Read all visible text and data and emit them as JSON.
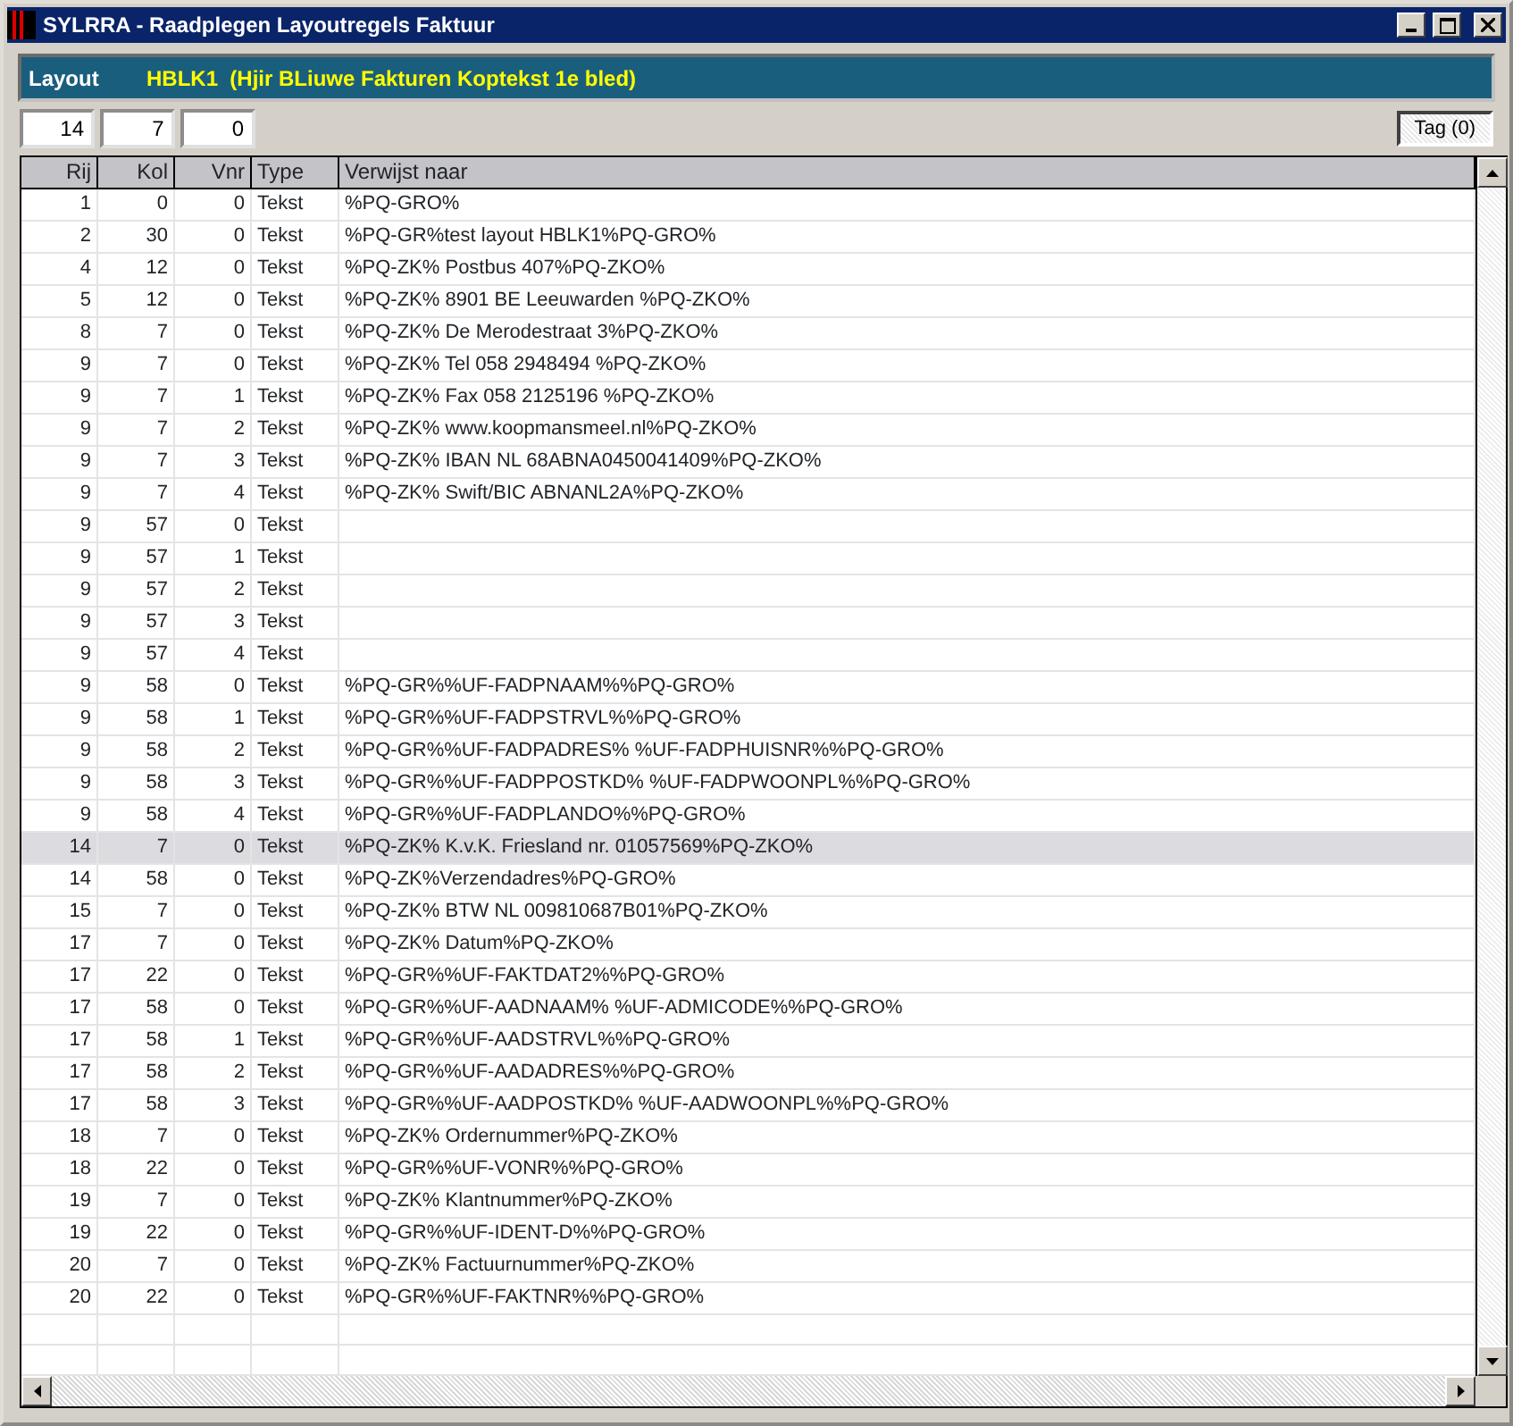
{
  "window": {
    "title": "SYLRRA - Raadplegen Layoutregels Faktuur"
  },
  "layout": {
    "label": "Layout",
    "value": "HBLK1  (Hjir BLiuwe Fakturen Koptekst 1e bled)"
  },
  "fields": [
    "14",
    "7",
    "0"
  ],
  "tag_button": "Tag (0)",
  "table": {
    "columns": [
      "Rij",
      "Kol",
      "Vnr",
      "Type",
      "Verwijst naar"
    ],
    "rows": [
      {
        "rij": "1",
        "kol": "0",
        "vnr": "0",
        "type": "Tekst",
        "ref": "%PQ-GRO%",
        "selected": false
      },
      {
        "rij": "2",
        "kol": "30",
        "vnr": "0",
        "type": "Tekst",
        "ref": "%PQ-GR%test layout HBLK1%PQ-GRO%",
        "selected": false
      },
      {
        "rij": "4",
        "kol": "12",
        "vnr": "0",
        "type": "Tekst",
        "ref": "%PQ-ZK% Postbus 407%PQ-ZKO%",
        "selected": false
      },
      {
        "rij": "5",
        "kol": "12",
        "vnr": "0",
        "type": "Tekst",
        "ref": "%PQ-ZK% 8901 BE Leeuwarden %PQ-ZKO%",
        "selected": false
      },
      {
        "rij": "8",
        "kol": "7",
        "vnr": "0",
        "type": "Tekst",
        "ref": "%PQ-ZK% De Merodestraat 3%PQ-ZKO%",
        "selected": false
      },
      {
        "rij": "9",
        "kol": "7",
        "vnr": "0",
        "type": "Tekst",
        "ref": "%PQ-ZK% Tel 058 2948494 %PQ-ZKO%",
        "selected": false
      },
      {
        "rij": "9",
        "kol": "7",
        "vnr": "1",
        "type": "Tekst",
        "ref": "%PQ-ZK% Fax 058 2125196 %PQ-ZKO%",
        "selected": false
      },
      {
        "rij": "9",
        "kol": "7",
        "vnr": "2",
        "type": "Tekst",
        "ref": "%PQ-ZK% www.koopmansmeel.nl%PQ-ZKO%",
        "selected": false
      },
      {
        "rij": "9",
        "kol": "7",
        "vnr": "3",
        "type": "Tekst",
        "ref": "%PQ-ZK% IBAN NL 68ABNA0450041409%PQ-ZKO%",
        "selected": false
      },
      {
        "rij": "9",
        "kol": "7",
        "vnr": "4",
        "type": "Tekst",
        "ref": "%PQ-ZK% Swift/BIC ABNANL2A%PQ-ZKO%",
        "selected": false
      },
      {
        "rij": "9",
        "kol": "57",
        "vnr": "0",
        "type": "Tekst",
        "selected": false
      },
      {
        "rij": "9",
        "kol": "57",
        "vnr": "1",
        "type": "Tekst",
        "selected": false
      },
      {
        "rij": "9",
        "kol": "57",
        "vnr": "2",
        "type": "Tekst",
        "selected": false
      },
      {
        "rij": "9",
        "kol": "57",
        "vnr": "3",
        "type": "Tekst",
        "selected": false
      },
      {
        "rij": "9",
        "kol": "57",
        "vnr": "4",
        "type": "Tekst",
        "selected": false
      },
      {
        "rij": "9",
        "kol": "58",
        "vnr": "0",
        "type": "Tekst",
        "ref": "%PQ-GR%%UF-FADPNAAM%%PQ-GRO%",
        "selected": false
      },
      {
        "rij": "9",
        "kol": "58",
        "vnr": "1",
        "type": "Tekst",
        "ref": "%PQ-GR%%UF-FADPSTRVL%%PQ-GRO%",
        "selected": false
      },
      {
        "rij": "9",
        "kol": "58",
        "vnr": "2",
        "type": "Tekst",
        "ref": "%PQ-GR%%UF-FADPADRES% %UF-FADPHUISNR%%PQ-GRO%",
        "selected": false
      },
      {
        "rij": "9",
        "kol": "58",
        "vnr": "3",
        "type": "Tekst",
        "ref": "%PQ-GR%%UF-FADPPOSTKD%  %UF-FADPWOONPL%%PQ-GRO%",
        "selected": false
      },
      {
        "rij": "9",
        "kol": "58",
        "vnr": "4",
        "type": "Tekst",
        "ref": "%PQ-GR%%UF-FADPLANDO%%PQ-GRO%",
        "selected": false
      },
      {
        "rij": "14",
        "kol": "7",
        "vnr": "0",
        "type": "Tekst",
        "ref": "%PQ-ZK% K.v.K. Friesland nr. 01057569%PQ-ZKO%",
        "selected": true
      },
      {
        "rij": "14",
        "kol": "58",
        "vnr": "0",
        "type": "Tekst",
        "ref": "%PQ-ZK%Verzendadres%PQ-GRO%",
        "selected": false
      },
      {
        "rij": "15",
        "kol": "7",
        "vnr": "0",
        "type": "Tekst",
        "ref": "%PQ-ZK% BTW NL 009810687B01%PQ-ZKO%",
        "selected": false
      },
      {
        "rij": "17",
        "kol": "7",
        "vnr": "0",
        "type": "Tekst",
        "ref": "%PQ-ZK% Datum%PQ-ZKO%",
        "selected": false
      },
      {
        "rij": "17",
        "kol": "22",
        "vnr": "0",
        "type": "Tekst",
        "ref": "%PQ-GR%%UF-FAKTDAT2%%PQ-GRO%",
        "selected": false
      },
      {
        "rij": "17",
        "kol": "58",
        "vnr": "0",
        "type": "Tekst",
        "ref": "%PQ-GR%%UF-AADNAAM% %UF-ADMICODE%%PQ-GRO%",
        "selected": false
      },
      {
        "rij": "17",
        "kol": "58",
        "vnr": "1",
        "type": "Tekst",
        "ref": "%PQ-GR%%UF-AADSTRVL%%PQ-GRO%",
        "selected": false
      },
      {
        "rij": "17",
        "kol": "58",
        "vnr": "2",
        "type": "Tekst",
        "ref": "%PQ-GR%%UF-AADADRES%%PQ-GRO%",
        "selected": false
      },
      {
        "rij": "17",
        "kol": "58",
        "vnr": "3",
        "type": "Tekst",
        "ref": "%PQ-GR%%UF-AADPOSTKD%  %UF-AADWOONPL%%PQ-GRO%",
        "selected": false
      },
      {
        "rij": "18",
        "kol": "7",
        "vnr": "0",
        "type": "Tekst",
        "ref": "%PQ-ZK% Ordernummer%PQ-ZKO%",
        "selected": false
      },
      {
        "rij": "18",
        "kol": "22",
        "vnr": "0",
        "type": "Tekst",
        "ref": "%PQ-GR%%UF-VONR%%PQ-GRO%",
        "selected": false
      },
      {
        "rij": "19",
        "kol": "7",
        "vnr": "0",
        "type": "Tekst",
        "ref": "%PQ-ZK% Klantnummer%PQ-ZKO%",
        "selected": false
      },
      {
        "rij": "19",
        "kol": "22",
        "vnr": "0",
        "type": "Tekst",
        "ref": "%PQ-GR%%UF-IDENT-D%%PQ-GRO%",
        "selected": false
      },
      {
        "rij": "20",
        "kol": "7",
        "vnr": "0",
        "type": "Tekst",
        "ref": "%PQ-ZK% Factuurnummer%PQ-ZKO%",
        "selected": false
      },
      {
        "rij": "20",
        "kol": "22",
        "vnr": "0",
        "type": "Tekst",
        "ref": "%PQ-GR%%UF-FAKTNR%%PQ-GRO%",
        "selected": false
      }
    ]
  }
}
